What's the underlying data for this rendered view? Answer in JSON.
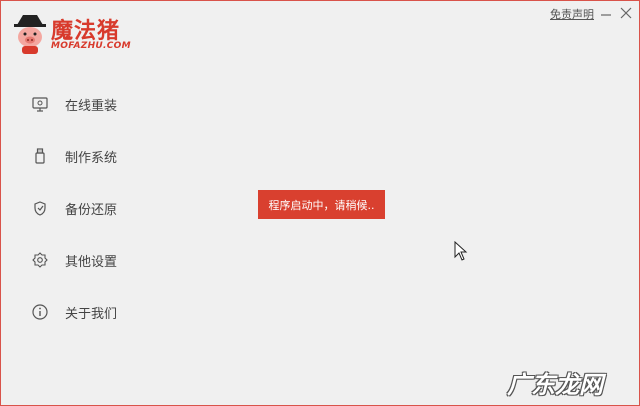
{
  "brand": {
    "title": "魔法猪",
    "subtitle": "MOFAZHU.COM",
    "accent_color": "#d83a2c"
  },
  "header": {
    "disclaimer_label": "免责声明",
    "minimize_icon": "minimize-icon",
    "close_icon": "close-icon"
  },
  "sidebar": {
    "items": [
      {
        "label": "在线重装",
        "icon": "monitor-icon"
      },
      {
        "label": "制作系统",
        "icon": "usb-drive-icon"
      },
      {
        "label": "备份还原",
        "icon": "backup-restore-icon"
      },
      {
        "label": "其他设置",
        "icon": "gear-icon"
      },
      {
        "label": "关于我们",
        "icon": "info-icon"
      }
    ]
  },
  "toast": {
    "message": "程序启动中，请稍候..",
    "color": "#d9402f"
  },
  "watermark": {
    "text": "广东龙网"
  }
}
